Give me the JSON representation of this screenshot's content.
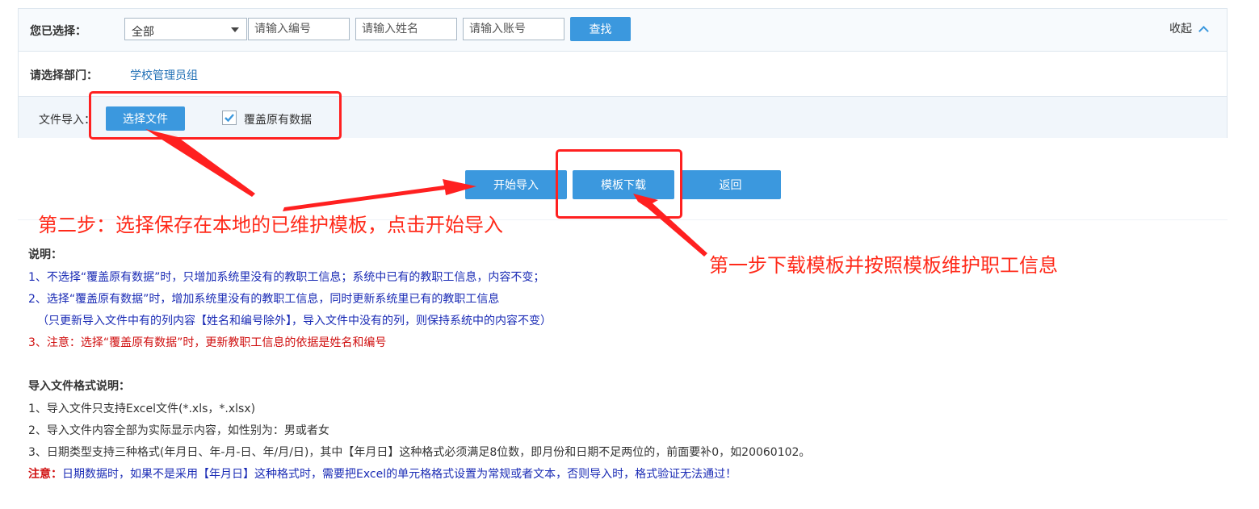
{
  "filter": {
    "label": "您已选择：",
    "select_value": "全部",
    "number_placeholder": "请输入编号",
    "name_placeholder": "请输入姓名",
    "account_placeholder": "请输入账号",
    "search_label": "查找",
    "collapse_label": "收起"
  },
  "department": {
    "label": "请选择部门：",
    "value": "学校管理员组"
  },
  "import": {
    "label": "文件导入：",
    "choose_file_label": "选择文件",
    "overwrite_label": "覆盖原有数据",
    "overwrite_checked": true
  },
  "actions": {
    "start_import": "开始导入",
    "template_download": "模板下载",
    "back": "返回"
  },
  "annotations": {
    "step2": "第二步：选择保存在本地的已维护模板，点击开始导入",
    "step1": "第一步下载模板并按照模板维护职工信息"
  },
  "notes": {
    "title": "说明：",
    "line1": "1、不选择“覆盖原有数据”时，只增加系统里没有的教职工信息；系统中已有的教职工信息，内容不变；",
    "line2": "2、选择“覆盖原有数据”时，增加系统里没有的教职工信息，同时更新系统里已有的教职工信息",
    "line3": "（只更新导入文件中有的列内容【姓名和编号除外】，导入文件中没有的列，则保持系统中的内容不变）",
    "line4": "3、注意：选择“覆盖原有数据”时，更新教职工信息的依据是姓名和编号"
  },
  "format": {
    "title": "导入文件格式说明：",
    "line1": "1、导入文件只支持Excel文件(*.xls，*.xlsx)",
    "line2": "2、导入文件内容全部为实际显示内容，如性别为：男或者女",
    "line3": "3、日期类型支持三种格式(年月日、年-月-日、年/月/日)，其中【年月日】这种格式必须满足8位数，即月份和日期不足两位的，前面要补0，如20060102。",
    "warning_label": "注意：",
    "warning_text": "日期数据时，如果不是采用【年月日】这种格式时，需要把Excel的单元格格式设置为常规或者文本，否则导入时，格式验证无法通过！"
  },
  "colors": {
    "accent": "#3b98de",
    "annotation_red": "#ff2020",
    "note_blue": "#1a2bb5",
    "note_red": "#d01010"
  }
}
